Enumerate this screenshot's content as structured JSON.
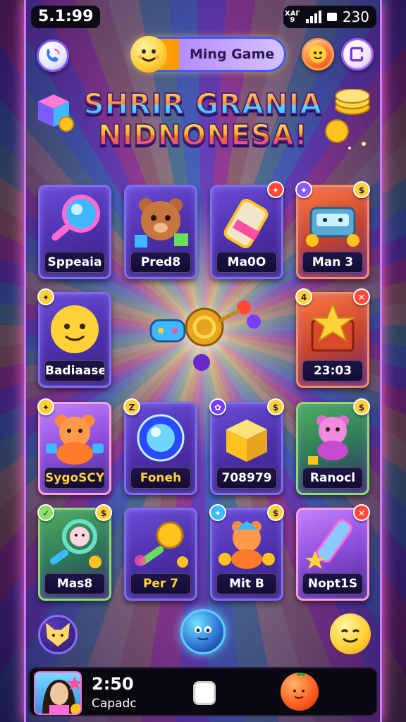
{
  "status_bar": {
    "time": "5.1:99",
    "network_top": "ХАГ",
    "network_bottom": "9",
    "battery_text": "230"
  },
  "header": {
    "title": "Ming Game",
    "left_icon": "phone-icon",
    "right_icons": [
      "emoji-face-icon",
      "exit-door-icon"
    ]
  },
  "logo": {
    "line1": "SHRIR GRANIA",
    "line2": "NIDNONESA!"
  },
  "grid": {
    "cards": [
      {
        "label": "Sppeaia",
        "art": "magnifier-icon",
        "badge_right": "",
        "badge_left": "",
        "theme": "blue",
        "label_gold": false
      },
      {
        "label": "Pred8",
        "art": "bear-icon",
        "badge_right": "",
        "badge_left": "",
        "theme": "blue",
        "label_gold": false
      },
      {
        "label": "Ma0O",
        "art": "battery-tube-icon",
        "badge_right": "",
        "badge_left": "",
        "theme": "blue",
        "label_gold": false
      },
      {
        "label": "Man 3",
        "art": "robot-box-icon",
        "badge_right": "",
        "badge_left": "",
        "theme": "orange",
        "label_gold": false
      },
      {
        "label": "Badiaases",
        "art": "smiley-icon",
        "badge_right": "",
        "badge_left": "",
        "theme": "blue",
        "label_gold": false
      },
      {
        "label": "23:03",
        "art": "star-box-icon",
        "badge_right": "",
        "badge_left": "4",
        "theme": "orange",
        "label_gold": false
      },
      {
        "label": "SygoSCY",
        "art": "teddy-bear-icon",
        "badge_right": "",
        "badge_left": "",
        "theme": "pink",
        "label_gold": true
      },
      {
        "label": "Foneh",
        "art": "blue-orb-icon",
        "badge_right": "",
        "badge_left": "Z",
        "theme": "blue",
        "label_gold": true
      },
      {
        "label": "708979",
        "art": "yellow-cube-icon",
        "badge_right": "",
        "badge_left": "",
        "theme": "blue",
        "label_gold": false
      },
      {
        "label": "Ranocl",
        "art": "pink-bear-icon",
        "badge_right": "",
        "badge_left": "",
        "theme": "green",
        "label_gold": false
      },
      {
        "label": "Mas8",
        "art": "bunny-wand-icon",
        "badge_right": "",
        "badge_left": "",
        "theme": "green",
        "label_gold": false
      },
      {
        "label": "Per 7",
        "art": "coin-wand-icon",
        "badge_right": "",
        "badge_left": "",
        "theme": "blue",
        "label_gold": true
      },
      {
        "label": "Mit B",
        "art": "bear-coins-icon",
        "badge_right": "",
        "badge_left": "",
        "theme": "blue",
        "label_gold": false
      },
      {
        "label": "Nopt1S",
        "art": "star-tube-icon",
        "badge_right": "",
        "badge_left": "",
        "theme": "pink",
        "label_gold": false
      }
    ]
  },
  "center_art": "gamepad-knot-icon",
  "bottom_buttons": [
    "fox-icon",
    "blue-face-orb-icon",
    "smiley-icon"
  ],
  "bottom_bar": {
    "time": "2:50",
    "name": "Capadc",
    "home_icon": "home-key-icon",
    "right_icon": "orange-ball-icon"
  },
  "colors": {
    "accent_gold": "#ffd23a",
    "card_blue": "#4b2fa8",
    "card_orange": "#c9452c",
    "card_green": "#2e7a57",
    "frame_pink": "#ff6ad5"
  }
}
